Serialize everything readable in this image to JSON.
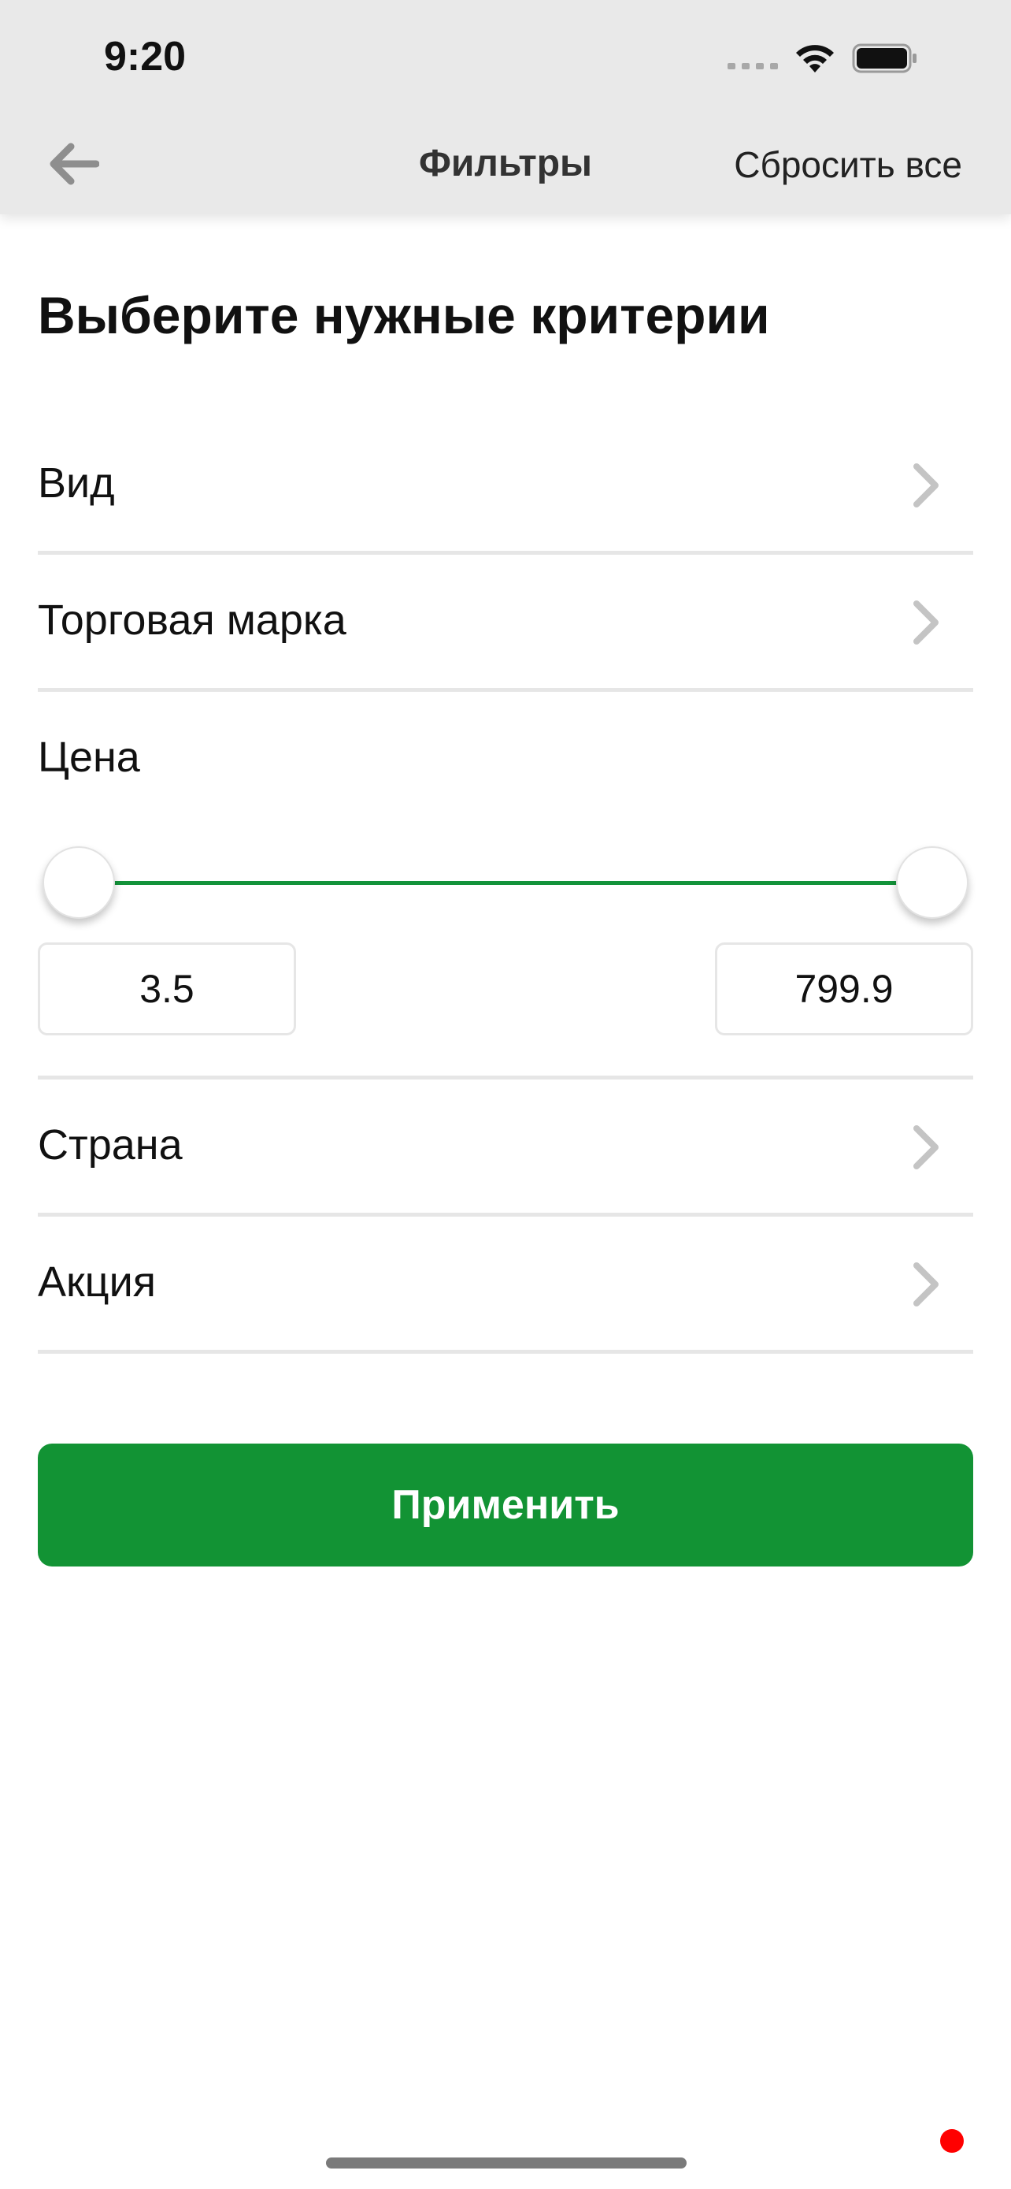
{
  "status_bar": {
    "time": "9:20",
    "icons": [
      "signal-dots-icon",
      "wifi-icon",
      "battery-icon"
    ]
  },
  "nav": {
    "back_icon": "arrow-left-icon",
    "title": "Фильтры",
    "reset_label": "Сбросить все"
  },
  "heading": "Выберите нужные критерии",
  "filters": {
    "kind": "Вид",
    "brand": "Торговая марка",
    "country": "Страна",
    "promo": "Акция",
    "chevron_icon": "chevron-right-icon"
  },
  "price": {
    "label": "Цена",
    "min_value": "3.5",
    "max_value": "799.9",
    "slider_min_fraction": 0.0,
    "slider_max_fraction": 1.0
  },
  "apply_label": "Применить",
  "colors": {
    "accent": "#129334",
    "header_bg": "#e9e9e9",
    "divider": "#e6e6e6"
  }
}
